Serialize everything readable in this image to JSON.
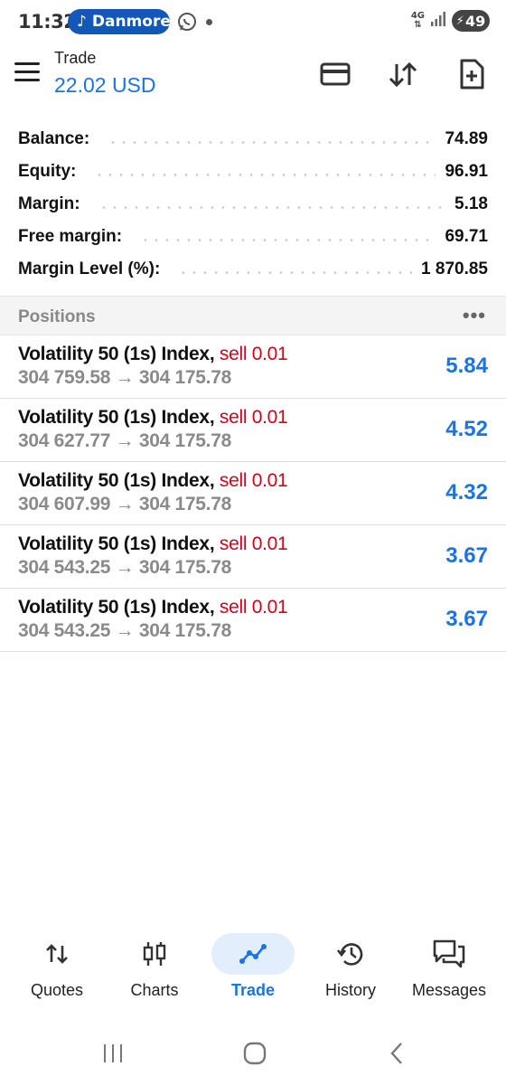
{
  "status_bar": {
    "time": "11:32",
    "media_pill": {
      "icon": "music-note-icon",
      "label": "Danmore"
    },
    "notification_icon": "whatsapp-icon",
    "network_label": "4G",
    "battery": "49",
    "pill_color": "#1357b8"
  },
  "app_bar": {
    "title": "Trade",
    "amount": "22.02 USD",
    "actions": [
      "card-icon",
      "sort-arrows-icon",
      "new-order-icon"
    ]
  },
  "summary": [
    {
      "label": "Balance:",
      "value": "74.89"
    },
    {
      "label": "Equity:",
      "value": "96.91"
    },
    {
      "label": "Margin:",
      "value": "5.18"
    },
    {
      "label": "Free margin:",
      "value": "69.71"
    },
    {
      "label": "Margin Level (%):",
      "value": "1 870.85"
    }
  ],
  "positions": {
    "title": "Positions",
    "more": "•••",
    "items": [
      {
        "symbol": "Volatility 50 (1s) Index,",
        "side": "sell 0.01",
        "prices": "304 759.58 → 304 175.78",
        "profit": "5.84"
      },
      {
        "symbol": "Volatility 50 (1s) Index,",
        "side": "sell 0.01",
        "prices": "304 627.77 → 304 175.78",
        "profit": "4.52"
      },
      {
        "symbol": "Volatility 50 (1s) Index,",
        "side": "sell 0.01",
        "prices": "304 607.99 → 304 175.78",
        "profit": "4.32"
      },
      {
        "symbol": "Volatility 50 (1s) Index,",
        "side": "sell 0.01",
        "prices": "304 543.25 → 304 175.78",
        "profit": "3.67"
      },
      {
        "symbol": "Volatility 50 (1s) Index,",
        "side": "sell 0.01",
        "prices": "304 543.25 → 304 175.78",
        "profit": "3.67"
      }
    ]
  },
  "bottom_nav": [
    {
      "label": "Quotes",
      "icon": "quotes-arrows-icon",
      "active": false
    },
    {
      "label": "Charts",
      "icon": "candlestick-icon",
      "active": false
    },
    {
      "label": "Trade",
      "icon": "trade-line-icon",
      "active": true
    },
    {
      "label": "History",
      "icon": "history-clock-icon",
      "active": false
    },
    {
      "label": "Messages",
      "icon": "messages-icon",
      "active": false
    }
  ],
  "colors": {
    "accent": "#1a73e8",
    "sell": "#d0021b",
    "active_nav_bg": "#e3eefc"
  }
}
